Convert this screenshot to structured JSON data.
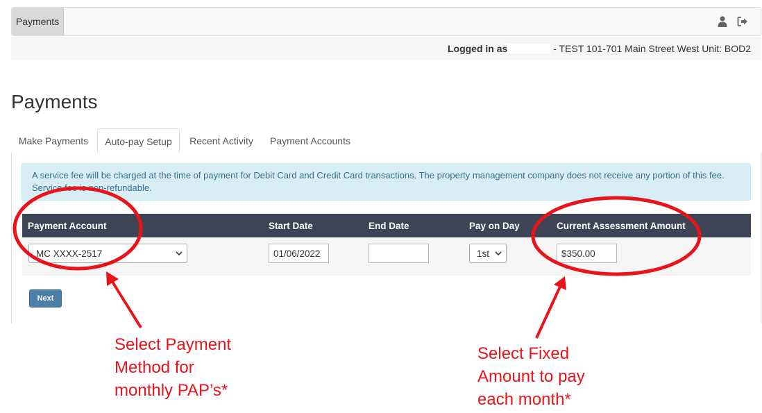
{
  "navbar": {
    "tab_label": "Payments",
    "user_icon": "user-icon",
    "logout_icon": "logout-icon"
  },
  "login_bar": {
    "prefix": "Logged in as",
    "suffix": " - TEST 101-701 Main Street West Unit: BOD2"
  },
  "page": {
    "title": "Payments"
  },
  "tabs": [
    {
      "label": "Make Payments",
      "active": false
    },
    {
      "label": "Auto-pay Setup",
      "active": true
    },
    {
      "label": "Recent Activity",
      "active": false
    },
    {
      "label": "Payment Accounts",
      "active": false
    }
  ],
  "alert": {
    "text": "A service fee will be charged at the time of payment for Debit Card and Credit Card transactions. The property management company does not receive any portion of this fee. Service fee is non-refundable."
  },
  "table": {
    "headers": {
      "payment_account": "Payment Account",
      "start_date": "Start Date",
      "end_date": "End Date",
      "pay_on_day": "Pay on Day",
      "current_assessment_amount": "Current Assessment Amount"
    },
    "row": {
      "payment_account": "MC XXXX-2517",
      "start_date": "01/06/2022",
      "end_date": "",
      "pay_on_day": "1st",
      "current_assessment_amount": "$350.00"
    }
  },
  "buttons": {
    "next": "Next"
  },
  "annotations": {
    "left": "Select Payment\nMethod for\nmonthly PAP’s*",
    "right": "Select Fixed\nAmount to pay\neach month*",
    "color": "#e8141b"
  },
  "colors": {
    "table_header": "#3c4456",
    "alert_bg": "#d9edf7",
    "alert_text": "#31708f",
    "next_button": "#4a7fa8"
  }
}
